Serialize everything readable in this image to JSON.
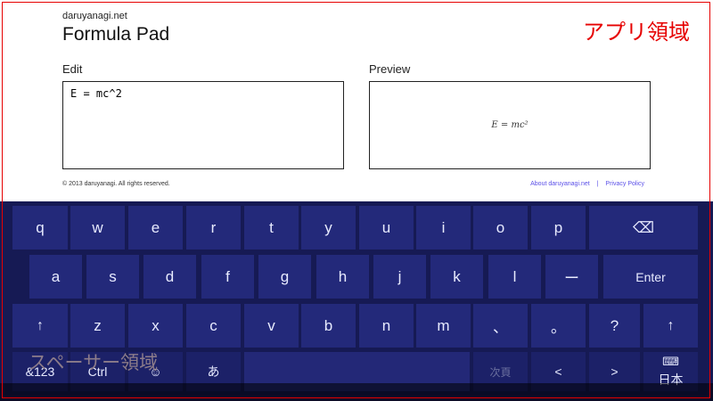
{
  "header": {
    "site": "daruyanagi.net",
    "title": "Formula Pad"
  },
  "editor": {
    "edit_label": "Edit",
    "edit_value": "E = mc^2",
    "preview_label": "Preview",
    "preview_value": "E = mc²"
  },
  "footer": {
    "copyright": "© 2013 daruyanagi. All rights reserved.",
    "about_link": "About daruyanagi.net",
    "separator": "|",
    "privacy_link": "Privacy Policy"
  },
  "annotations": {
    "app_area": "アプリ領域",
    "spacer_area": "スペーサー領域",
    "color": "#e60000"
  },
  "keyboard": {
    "row1": [
      "q",
      "w",
      "e",
      "r",
      "t",
      "y",
      "u",
      "i",
      "o",
      "p"
    ],
    "row2": [
      "a",
      "s",
      "d",
      "f",
      "g",
      "h",
      "j",
      "k",
      "l",
      "ー"
    ],
    "row3": [
      "z",
      "x",
      "c",
      "v",
      "b",
      "n",
      "m",
      "、",
      "。",
      "?"
    ],
    "enter": "Enter",
    "backspace_icon": "⌫",
    "shift_icon": "↑",
    "bottom": {
      "symbols": "&123",
      "ctrl": "Ctrl",
      "emoji_icon": "☺",
      "kana": "あ",
      "next_candidate": "次頁",
      "left_icon": "<",
      "right_icon": ">",
      "keyboard_icon": "⌨",
      "layout_label": "日本"
    }
  }
}
